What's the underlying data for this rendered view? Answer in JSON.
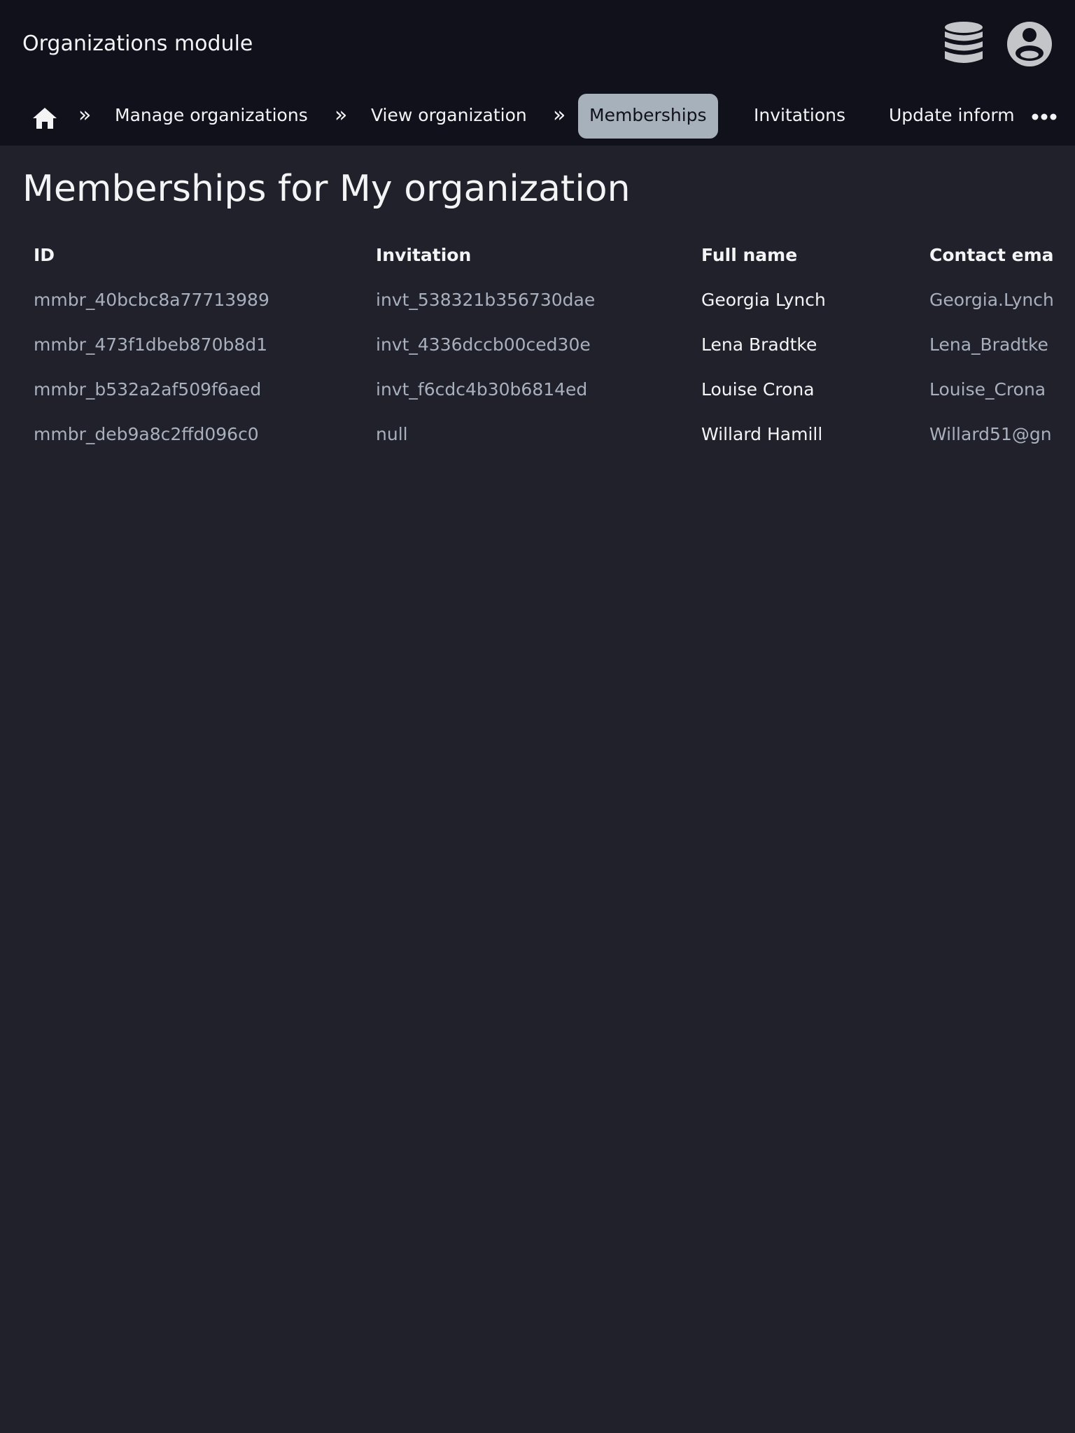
{
  "header": {
    "title": "Organizations module",
    "icons": {
      "database": "database-icon",
      "account": "account-circle-icon"
    }
  },
  "nav": {
    "home_icon": "home-icon",
    "separator": "»",
    "items": [
      {
        "label": "Manage organizations"
      },
      {
        "label": "View organization"
      },
      {
        "label": "Memberships",
        "active": true
      },
      {
        "label": "Invitations"
      },
      {
        "label": "Update inform"
      }
    ],
    "more_icon": "more-horizontal-icon"
  },
  "main": {
    "title": "Memberships for My organization",
    "table": {
      "columns": [
        "ID",
        "Invitation",
        "Full name",
        "Contact ema"
      ],
      "rows": [
        [
          "mmbr_40bcbc8a77713989",
          "invt_538321b356730dae",
          "Georgia Lynch",
          "Georgia.Lynch"
        ],
        [
          "mmbr_473f1dbeb870b8d1",
          "invt_4336dccb00ced30e",
          "Lena Bradtke",
          "Lena_Bradtke"
        ],
        [
          "mmbr_b532a2af509f6aed",
          "invt_f6cdc4b30b6814ed",
          "Louise Crona",
          "Louise_Crona"
        ],
        [
          "mmbr_deb9a8c2ffd096c0",
          "null",
          "Willard Hamill",
          "Willard51@gn"
        ]
      ]
    }
  },
  "colors": {
    "topbar_bg": "#10111b",
    "page_bg": "#20212b",
    "active_tab_bg": "#a7b1bc",
    "muted_text": "#a9b0bd",
    "text": "#f4f4f6",
    "icon_gray": "#c4c5c9"
  }
}
